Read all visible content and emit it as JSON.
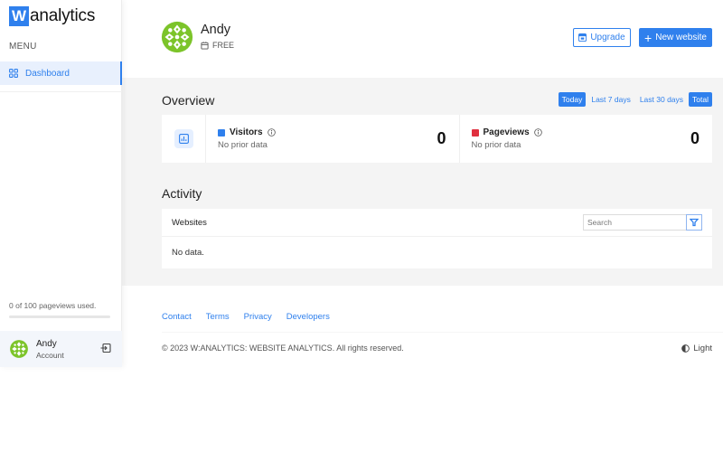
{
  "app": {
    "logo_letter": "W",
    "logo_text": "analytics"
  },
  "sidebar": {
    "menu_label": "MENU",
    "items": [
      {
        "label": "Dashboard",
        "icon": "grid-icon",
        "active": true
      }
    ],
    "usage_text": "0 of 100 pageviews used.",
    "usage_fraction": 0,
    "account": {
      "name": "Andy",
      "subtitle": "Account",
      "logout_icon": "logout-icon"
    }
  },
  "header": {
    "user_name": "Andy",
    "plan": "FREE",
    "upgrade_label": "Upgrade",
    "new_website_label": "New website"
  },
  "overview": {
    "title": "Overview",
    "ranges": [
      {
        "label": "Today",
        "active": true
      },
      {
        "label": "Last 7 days",
        "active": false
      },
      {
        "label": "Last 30 days",
        "active": false
      },
      {
        "label": "Total",
        "active": true
      }
    ],
    "stats": [
      {
        "label": "Visitors",
        "sub": "No prior data",
        "value": "0",
        "color": "#2f80ed"
      },
      {
        "label": "Pageviews",
        "sub": "No prior data",
        "value": "0",
        "color": "#e0303f"
      }
    ]
  },
  "activity": {
    "title": "Activity",
    "table_title": "Websites",
    "search_placeholder": "Search",
    "empty_text": "No data."
  },
  "footer": {
    "links": [
      "Contact",
      "Terms",
      "Privacy",
      "Developers"
    ],
    "copyright": "© 2023 W:ANALYTICS: WEBSITE ANALYTICS. All rights reserved.",
    "theme_label": "Light"
  },
  "colors": {
    "accent": "#2f80ed",
    "avatar_green": "#7cc42a"
  }
}
